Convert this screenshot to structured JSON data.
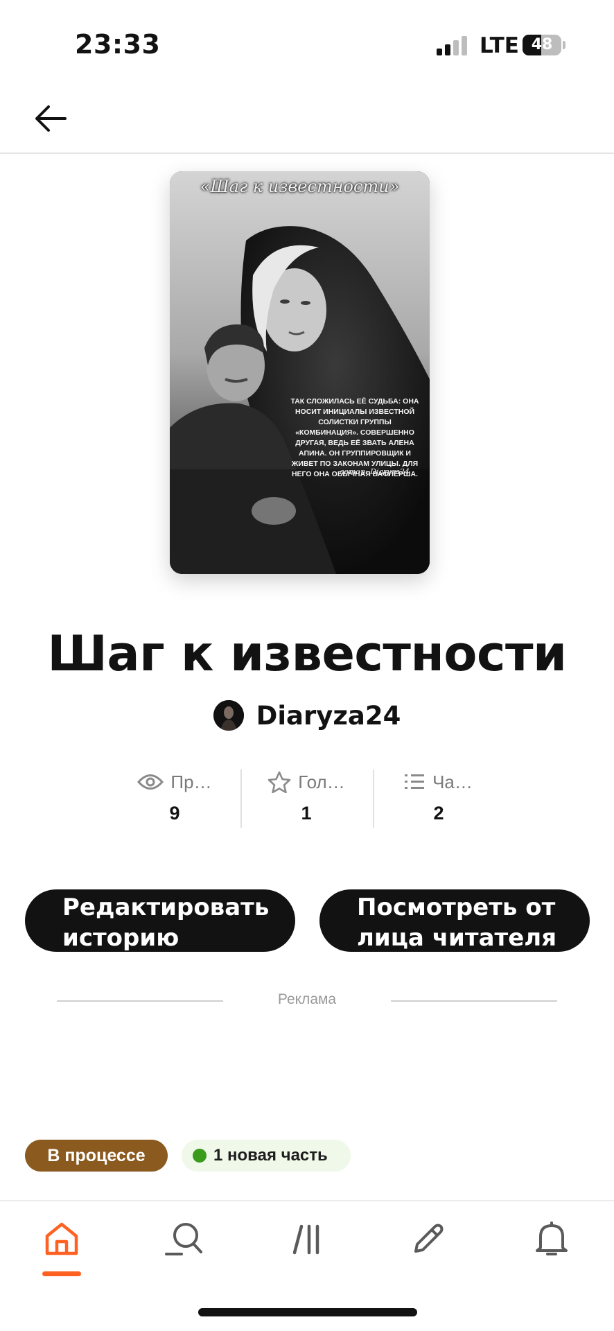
{
  "status_bar": {
    "time": "23:33",
    "network": "LTE",
    "battery": "48",
    "battery_level": 0.48
  },
  "header": {
    "back_icon": "arrow-left-icon"
  },
  "book": {
    "cover": {
      "title": "«Шаг к известности»",
      "blurb": "Так сложилась её судьба: она носит инициалы известной солистки группы «Комбинация». Совершенно другая, ведь её звать Алена Апина. Он группировщик и живет по законам улицы. Для него она обычная вафлёрша.",
      "author_line": "автор: Diaryza24"
    },
    "title": "Шаг к известности",
    "author": "Diaryza24"
  },
  "stats": [
    {
      "icon": "eye-icon",
      "label": "Пр…",
      "value": "9"
    },
    {
      "icon": "star-icon",
      "label": "Гол…",
      "value": "1"
    },
    {
      "icon": "list-icon",
      "label": "Ча…",
      "value": "2"
    }
  ],
  "actions": {
    "edit_label": "Редактировать историю",
    "preview_label": "Посмотреть от лица читателя"
  },
  "ad": {
    "label": "Реклама"
  },
  "tags": {
    "status": "В процессе",
    "new_parts": "1 новая часть"
  },
  "nav": {
    "items": [
      {
        "icon": "home-icon",
        "active": true
      },
      {
        "icon": "search-icon",
        "active": false
      },
      {
        "icon": "library-icon",
        "active": false
      },
      {
        "icon": "pencil-icon",
        "active": false
      },
      {
        "icon": "bell-icon",
        "active": false
      }
    ]
  },
  "colors": {
    "accent": "#ff6122",
    "status_tag": "#8b5a1f",
    "new_dot": "#3a9b1d",
    "button_bg": "#121212"
  }
}
